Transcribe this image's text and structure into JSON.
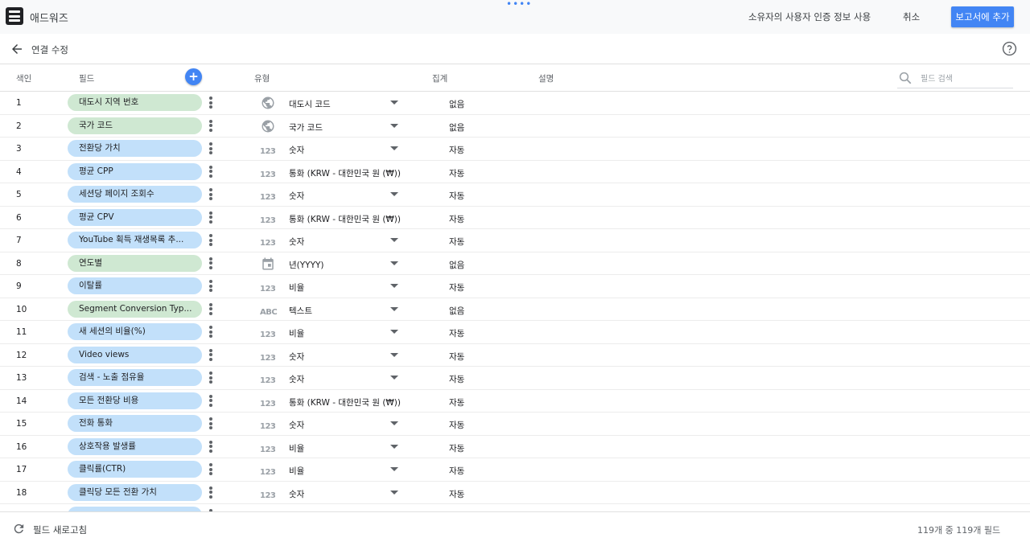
{
  "app": {
    "title": "애드워즈"
  },
  "toolbar": {
    "owner_credentials": "소유자의 사용자 인증 정보 사용",
    "cancel": "취소",
    "add_to_report": "보고서에 추가"
  },
  "subheader": {
    "title": "연결 수정"
  },
  "columns": {
    "index": "색인",
    "field": "필드",
    "type": "유형",
    "aggregation": "집계",
    "description": "설명"
  },
  "search": {
    "placeholder": "필드 검색"
  },
  "rows": [
    {
      "index": "1",
      "field": "대도시 지역 번호",
      "kind": "dimension",
      "icon": "globe-icon",
      "type": "대도시 코드",
      "dropdown": true,
      "agg": "없음"
    },
    {
      "index": "2",
      "field": "국가 코드",
      "kind": "dimension",
      "icon": "globe-icon",
      "type": "국가 코드",
      "dropdown": true,
      "agg": "없음"
    },
    {
      "index": "3",
      "field": "전환당 가치",
      "kind": "metric",
      "icon": "number-icon",
      "type": "숫자",
      "dropdown": true,
      "agg": "자동"
    },
    {
      "index": "4",
      "field": "평균 CPP",
      "kind": "metric",
      "icon": "number-icon",
      "type": "통화 (KRW - 대한민국 원 (₩))",
      "dropdown": false,
      "agg": "자동"
    },
    {
      "index": "5",
      "field": "세션당 페이지 조회수",
      "kind": "metric",
      "icon": "number-icon",
      "type": "숫자",
      "dropdown": true,
      "agg": "자동"
    },
    {
      "index": "6",
      "field": "평균 CPV",
      "kind": "metric",
      "icon": "number-icon",
      "type": "통화 (KRW - 대한민국 원 (₩))",
      "dropdown": false,
      "agg": "자동"
    },
    {
      "index": "7",
      "field": "YouTube 획득 재생목록 추...",
      "kind": "metric",
      "icon": "number-icon",
      "type": "숫자",
      "dropdown": true,
      "agg": "자동"
    },
    {
      "index": "8",
      "field": "연도별",
      "kind": "dimension",
      "icon": "calendar-icon",
      "type": "년(YYYY)",
      "dropdown": true,
      "agg": "없음"
    },
    {
      "index": "9",
      "field": "이탈률",
      "kind": "metric",
      "icon": "number-icon",
      "type": "비율",
      "dropdown": true,
      "agg": "자동"
    },
    {
      "index": "10",
      "field": "Segment Conversion Typ...",
      "kind": "dimension",
      "icon": "text-icon",
      "type": "텍스트",
      "dropdown": true,
      "agg": "없음"
    },
    {
      "index": "11",
      "field": "새 세션의 비율(%)",
      "kind": "metric",
      "icon": "number-icon",
      "type": "비율",
      "dropdown": true,
      "agg": "자동"
    },
    {
      "index": "12",
      "field": "Video views",
      "kind": "metric",
      "icon": "number-icon",
      "type": "숫자",
      "dropdown": true,
      "agg": "자동"
    },
    {
      "index": "13",
      "field": "검색 - 노출 점유율",
      "kind": "metric",
      "icon": "number-icon",
      "type": "숫자",
      "dropdown": true,
      "agg": "자동"
    },
    {
      "index": "14",
      "field": "모든 전환당 비용",
      "kind": "metric",
      "icon": "number-icon",
      "type": "통화 (KRW - 대한민국 원 (₩))",
      "dropdown": false,
      "agg": "자동"
    },
    {
      "index": "15",
      "field": "전화 통화",
      "kind": "metric",
      "icon": "number-icon",
      "type": "숫자",
      "dropdown": true,
      "agg": "자동"
    },
    {
      "index": "16",
      "field": "상호작용 발생률",
      "kind": "metric",
      "icon": "number-icon",
      "type": "비율",
      "dropdown": true,
      "agg": "자동"
    },
    {
      "index": "17",
      "field": "클릭률(CTR)",
      "kind": "metric",
      "icon": "number-icon",
      "type": "비율",
      "dropdown": true,
      "agg": "자동"
    },
    {
      "index": "18",
      "field": "클릭당 모든 전환 가치",
      "kind": "metric",
      "icon": "number-icon",
      "type": "숫자",
      "dropdown": true,
      "agg": "자동"
    },
    {
      "index": "",
      "field": "",
      "kind": "metric",
      "icon": "number-icon",
      "type": "",
      "dropdown": false,
      "agg": ""
    }
  ],
  "footer": {
    "refresh": "필드 새로고침",
    "count": "119개 중 119개 필드"
  },
  "icon_labels": {
    "number": "123",
    "text": "ABC"
  },
  "colors": {
    "accent": "#4285f4",
    "dimension": "#cfe8d2",
    "metric": "#c2e0fa"
  }
}
